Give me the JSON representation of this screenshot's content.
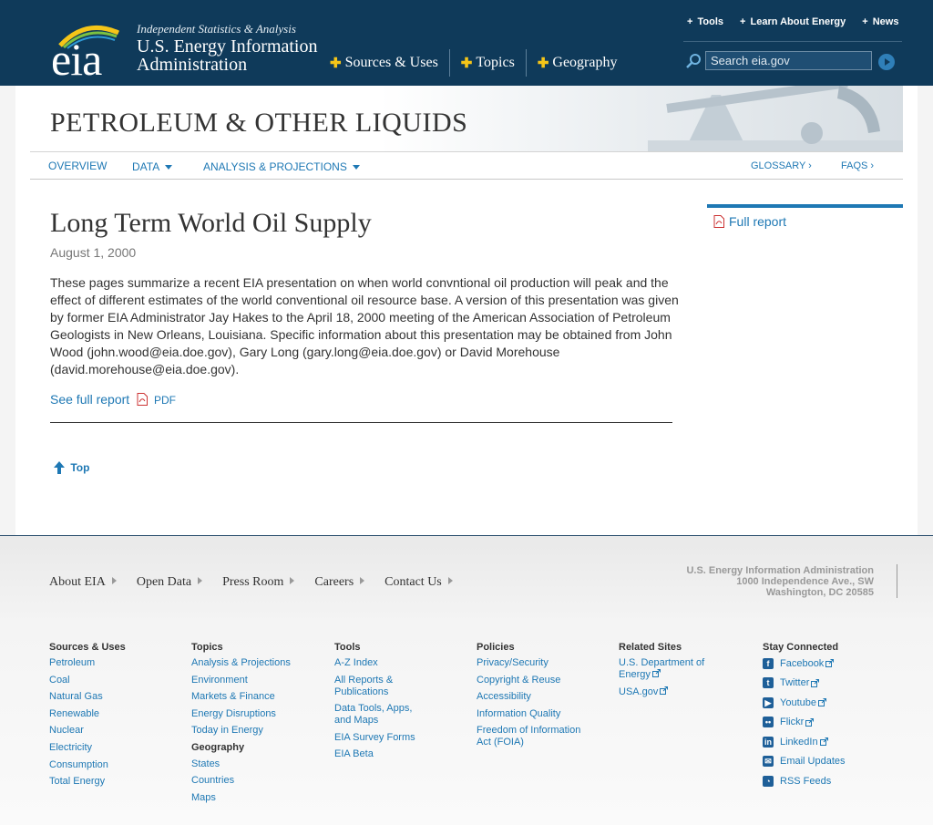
{
  "header": {
    "logo_text": "eia",
    "tagline": "Independent Statistics & Analysis",
    "agency_line1": "U.S. Energy Information",
    "agency_line2": "Administration",
    "main_nav": [
      "Sources & Uses",
      "Topics",
      "Geography"
    ],
    "util_nav": [
      "Tools",
      "Learn About Energy",
      "News"
    ],
    "search_placeholder": "Search eia.gov"
  },
  "banner": {
    "title": "PETROLEUM & OTHER LIQUIDS"
  },
  "subnav": {
    "overview": "OVERVIEW",
    "data": "DATA",
    "analysis": "ANALYSIS & PROJECTIONS",
    "glossary": "GLOSSARY ›",
    "faqs": "FAQS ›"
  },
  "article": {
    "title": "Long Term World Oil Supply",
    "date": "August 1, 2000",
    "body": "These pages summarize a recent EIA presentation on when world convntional oil production will peak and the effect of different estimates of the world conventional oil resource base. A version of this presentation was given by former EIA Administrator Jay Hakes to the April 18, 2000 meeting of the American Association of Petroleum Geologists in New Orleans, Louisiana. Specific information about this presentation may be obtained from John Wood (john.wood@eia.doe.gov), Gary Long (gary.long@eia.doe.gov) or David Morehouse (david.morehouse@eia.doe.gov).",
    "see_full_report": "See full report",
    "pdf_label": "PDF",
    "top_label": "Top"
  },
  "sidebar": {
    "full_report": "Full report"
  },
  "footer": {
    "nav": [
      "About EIA",
      "Open Data",
      "Press Room",
      "Careers",
      "Contact Us"
    ],
    "address": [
      "U.S. Energy Information Administration",
      "1000 Independence Ave., SW",
      "Washington, DC 20585"
    ],
    "columns": {
      "sources": {
        "title": "Sources & Uses",
        "links": [
          "Petroleum",
          "Coal",
          "Natural Gas",
          "Renewable",
          "Nuclear",
          "Electricity",
          "Consumption",
          "Total Energy"
        ]
      },
      "topics": {
        "title": "Topics",
        "links": [
          "Analysis & Projections",
          "Environment",
          "Markets & Finance",
          "Energy Disruptions",
          "Today in Energy"
        ],
        "sub_title": "Geography",
        "sub_links": [
          "States",
          "Countries",
          "Maps"
        ]
      },
      "tools": {
        "title": "Tools",
        "links": [
          "A-Z Index",
          "All Reports & Publications",
          "Data Tools, Apps, and Maps",
          "EIA Survey Forms",
          "EIA Beta"
        ]
      },
      "policies": {
        "title": "Policies",
        "links": [
          "Privacy/Security",
          "Copyright & Reuse",
          "Accessibility",
          "Information Quality",
          "Freedom of Information Act (FOIA)"
        ]
      },
      "related": {
        "title": "Related Sites",
        "links": [
          "U.S. Department of Energy",
          "USA.gov"
        ]
      },
      "connect": {
        "title": "Stay Connected",
        "links": [
          "Facebook",
          "Twitter",
          "Youtube",
          "Flickr",
          "LinkedIn",
          "Email Updates",
          "RSS Feeds"
        ]
      }
    }
  },
  "colors": {
    "header_bg": "#0f3a5a",
    "link": "#1e78b4",
    "accent_yellow": "#f5c518"
  },
  "icons": [
    "eia-logo-icon",
    "search-icon",
    "search-go-icon",
    "pdf-icon",
    "up-arrow-icon",
    "external-link-icon",
    "facebook-icon",
    "twitter-icon",
    "youtube-icon",
    "flickr-icon",
    "linkedin-icon",
    "email-icon",
    "rss-icon"
  ]
}
